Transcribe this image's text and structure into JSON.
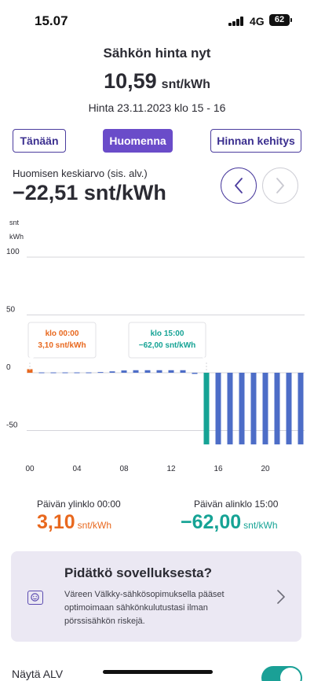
{
  "status_bar": {
    "time": "15.07",
    "network": "4G",
    "battery": "62"
  },
  "header": {
    "title": "Sähkön hinta nyt",
    "current_price": "10,59",
    "unit": "snt/kWh",
    "time_range": "Hinta 23.11.2023 klo 15 - 16"
  },
  "tabs": [
    {
      "label": "Tänään"
    },
    {
      "label": "Huomenna"
    },
    {
      "label": "Hinnan kehitys"
    }
  ],
  "average": {
    "label": "Huomisen keskiarvo (sis. alv.)",
    "value": "−22,51 snt/kWh"
  },
  "colors": {
    "brand": "#6a4cc9",
    "bar": "#4d6dc7",
    "high": "#e8681e",
    "low": "#16a395"
  },
  "chart_data": {
    "type": "bar",
    "ylabel": "snt\nkWh",
    "ylim": [
      -62,
      120
    ],
    "yticks": [
      100,
      50,
      0,
      -50
    ],
    "xticks": [
      "00",
      "04",
      "08",
      "12",
      "16",
      "20"
    ],
    "x": [
      0,
      1,
      2,
      3,
      4,
      5,
      6,
      7,
      8,
      9,
      10,
      11,
      12,
      13,
      14,
      15,
      16,
      17,
      18,
      19,
      20,
      21,
      22,
      23
    ],
    "values": [
      3.1,
      0.3,
      0.3,
      0.3,
      0.3,
      0.3,
      0.6,
      1.2,
      2.0,
      2.2,
      2.2,
      2.2,
      2.2,
      2.2,
      -1.0,
      -62.0,
      -62.0,
      -62.0,
      -62.0,
      -62.0,
      -62.0,
      -62.0,
      -62.0,
      -62.0
    ],
    "highlight_high_index": 0,
    "highlight_low_index": 15,
    "annotations": [
      {
        "line1": "klo 00:00",
        "line2": "3,10 snt/kWh"
      },
      {
        "line1": "klo 15:00",
        "line2": "−62,00 snt/kWh"
      }
    ]
  },
  "extremes": {
    "high_label": "Päivän ylinklo 00:00",
    "high_value": "3,10",
    "low_label": "Päivän alinklo 15:00",
    "low_value": "−62,00",
    "unit": "snt/kWh"
  },
  "promo": {
    "title": "Pidätkö sovelluksesta?",
    "text": "Väreen Välkky-sähkösopimuksella pääset optimoimaan sähkönkulutustasi ilman pörssisähkön riskejä.",
    "icon": "smiley-icon"
  },
  "settings": {
    "alv_label": "Näytä ALV",
    "alv_enabled": true
  }
}
